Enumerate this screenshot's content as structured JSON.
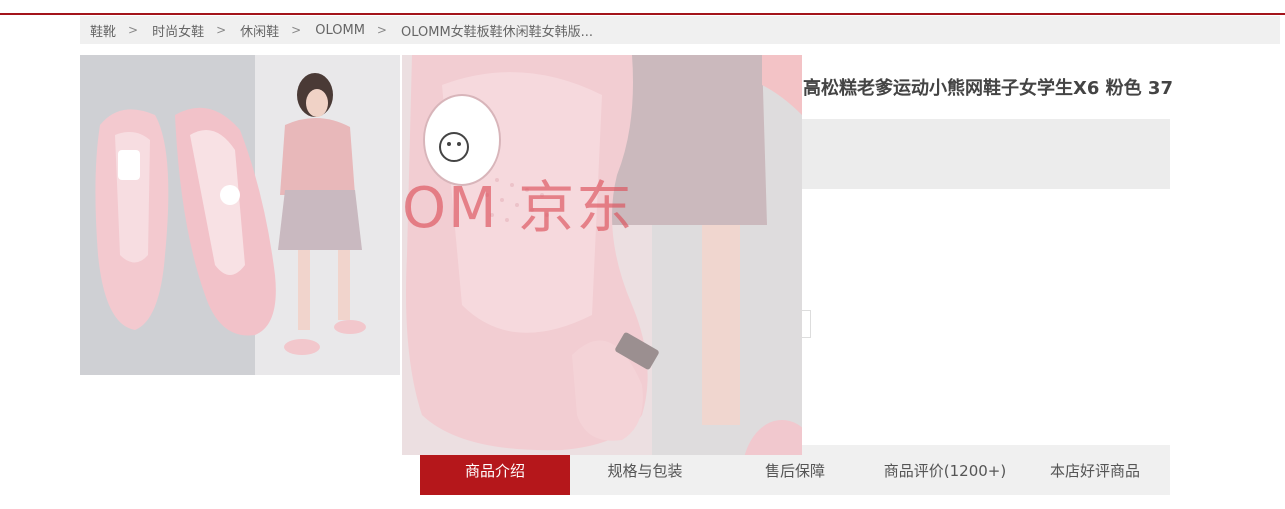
{
  "colors": {
    "accent": "#b5171b",
    "top_rule": "#a3141b",
    "breadcrumb_bg": "#f0f0f0",
    "tab_bar_bg": "#f0f0f0",
    "price_panel_bg": "#ececec"
  },
  "breadcrumb": {
    "items": [
      "鞋靴",
      "时尚女鞋",
      "休闲鞋",
      "OLOMM",
      "OLOMM女鞋板鞋休闲鞋女韩版..."
    ],
    "separator": ">"
  },
  "gallery": {
    "watermark": "OM 京东"
  },
  "product": {
    "title": "高松糕老爹运动小熊网鞋子女学生X6 粉色 37",
    "size_chip": "码"
  },
  "tabs": [
    {
      "label": "商品介绍",
      "active": true
    },
    {
      "label": "规格与包装",
      "active": false
    },
    {
      "label": "售后保障",
      "active": false
    },
    {
      "label": "商品评价(1200+)",
      "active": false
    },
    {
      "label": "本店好评商品",
      "active": false
    }
  ]
}
